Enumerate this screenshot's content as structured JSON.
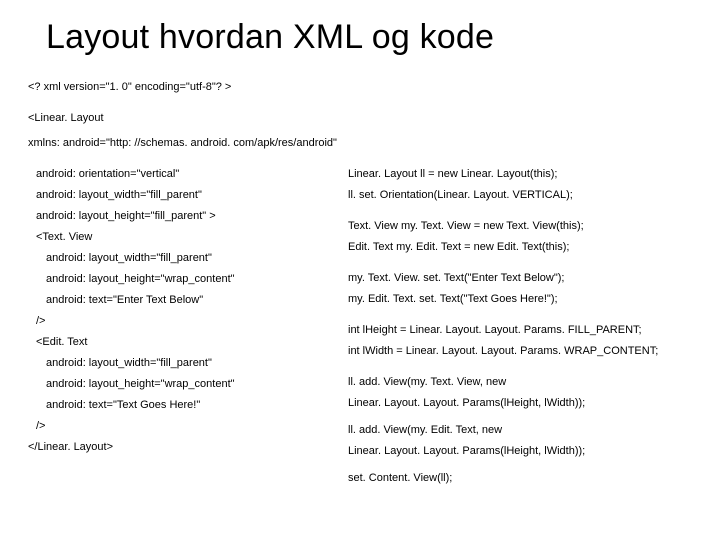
{
  "title": "Layout hvordan XML og kode",
  "head": {
    "l1": "<? xml version=\"1. 0\" encoding=\"utf-8\"? >",
    "l2": "<Linear. Layout",
    "l3": "xmlns: android=\"http: //schemas. android. com/apk/res/android\""
  },
  "left": {
    "r1": "android: orientation=\"vertical\"",
    "r2": "android: layout_width=\"fill_parent\"",
    "r3": "android: layout_height=\"fill_parent\" >",
    "r4": "<Text. View",
    "r5": "android: layout_width=\"fill_parent\"",
    "r6": "android: layout_height=\"wrap_content\"",
    "r7": "android: text=\"Enter Text Below\"",
    "r8": "/>",
    "r9": "<Edit. Text",
    "r10": "android: layout_width=\"fill_parent\"",
    "r11": "android: layout_height=\"wrap_content\"",
    "r12": "android: text=\"Text Goes Here!\"",
    "r13": "/>",
    "r14": "</Linear. Layout>"
  },
  "right": {
    "r1": "Linear. Layout ll = new Linear. Layout(this);",
    "r2": "ll. set. Orientation(Linear. Layout. VERTICAL);",
    "r3": "",
    "r4": "Text. View my. Text. View = new Text. View(this);",
    "r5": "Edit. Text my. Edit. Text = new Edit. Text(this);",
    "r6": "",
    "r7": "my. Text. View. set. Text(\"Enter Text Below\");",
    "r8": "my. Edit. Text. set. Text(\"Text Goes Here!\");",
    "r9": "",
    "r10": "int lHeight = Linear. Layout. Layout. Params. FILL_PARENT;",
    "r11": "int lWidth = Linear. Layout. Layout. Params. WRAP_CONTENT;",
    "r12": "",
    "r13a": "ll. add. View(my. Text. View, new",
    "r13b": "Linear. Layout. Layout. Params(lHeight, lWidth));",
    "r14a": "ll. add. View(my. Edit. Text, new",
    "r14b": "Linear. Layout. Layout. Params(lHeight, lWidth));",
    "r15": "set. Content. View(ll);"
  }
}
